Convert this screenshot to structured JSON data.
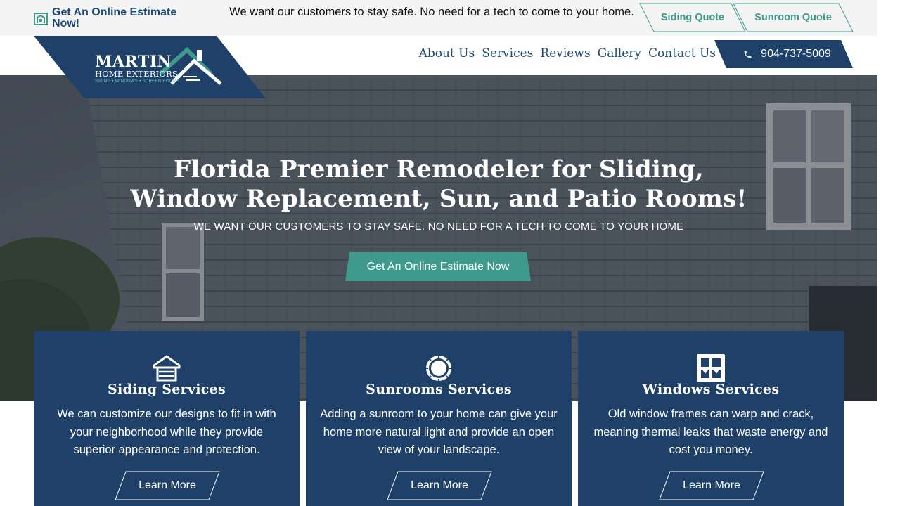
{
  "topbar": {
    "estimate_link": "Get An Online Estimate Now!",
    "message": "We want our customers to stay safe. No need for a tech to come to your home.",
    "siding_quote": "Siding Quote",
    "sunroom_quote": "Sunroom Quote"
  },
  "logo": {
    "name": "MARTIN",
    "line2": "HOME EXTERIORS",
    "tagline": "SIDING • WINDOWS • SCREEN ROOMS"
  },
  "nav": {
    "items": [
      "About Us",
      "Services",
      "Reviews",
      "Gallery",
      "Contact Us"
    ],
    "phone": "904-737-5009"
  },
  "hero": {
    "title_line1": "Florida Premier Remodeler for Sliding,",
    "title_line2": "Window Replacement, Sun, and Patio Rooms!",
    "subtitle": "WE WANT OUR CUSTOMERS TO STAY SAFE. NO NEED FOR A TECH TO COME TO YOUR HOME",
    "cta": "Get An Online Estimate Now"
  },
  "cards": [
    {
      "title": "Siding Services",
      "text": "We can customize our designs to fit in with your neighborhood while they provide superior appearance and protection.",
      "button": "Learn More",
      "icon": "house-siding-icon"
    },
    {
      "title": "Sunrooms Services",
      "text": "Adding a sunroom to your home can give your home more natural light and provide an open view of your landscape.",
      "button": "Learn More",
      "icon": "sun-icon"
    },
    {
      "title": "Windows Services",
      "text": "Old window frames can warp and crack, meaning thermal leaks that waste energy and cost you money.",
      "button": "Learn More",
      "icon": "window-icon"
    }
  ],
  "colors": {
    "navy": "#1f4068",
    "teal": "#3d9a8c",
    "topbar": "#f4f4f4"
  }
}
